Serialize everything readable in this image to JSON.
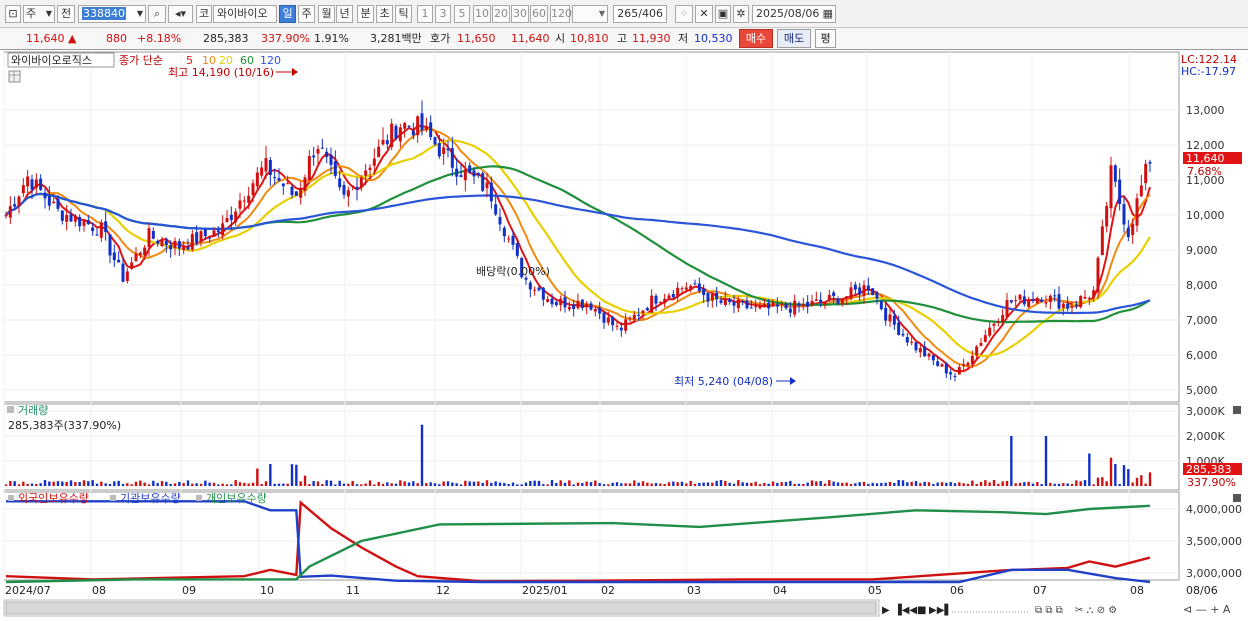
{
  "toolbar": {
    "period_label": "주",
    "prev_label": "전",
    "stock_code": "338840",
    "market_label": "코",
    "stock_name": "와이바이오",
    "periods": [
      "일",
      "주",
      "월",
      "년",
      "분",
      "초",
      "틱"
    ],
    "active_period": "일",
    "intervals": [
      "1",
      "3",
      "5",
      "10",
      "20",
      "30",
      "60",
      "120"
    ],
    "count_display": "265/406",
    "date": "2025/08/06"
  },
  "quote": {
    "price": "11,640",
    "change": "880",
    "change_pct": "+8.18%",
    "volume": "285,383",
    "volume_ratio": "337.90%",
    "turnover": "1.91%",
    "amount": "3,281백만",
    "ask_label": "호가",
    "ask1": "11,650",
    "bid1": "11,640",
    "open_label": "시",
    "open": "10,810",
    "high_label": "고",
    "high": "11,930",
    "low_label": "저",
    "low": "10,530",
    "buy_label": "매수",
    "sell_label": "매도",
    "avg_label": "평"
  },
  "price_panel": {
    "stock_name_label": "와이바이오로직스",
    "ma_title": "종가 단순",
    "ma_periods": [
      {
        "label": "5",
        "color": "#e01414"
      },
      {
        "label": "10",
        "color": "#f08a10"
      },
      {
        "label": "20",
        "color": "#e8d000"
      },
      {
        "label": "60",
        "color": "#1f8f3a"
      },
      {
        "label": "120",
        "color": "#2a55d8"
      }
    ],
    "high_annotation": "최고 14,190 (10/16)",
    "low_annotation": "최저 5,240 (04/08)",
    "dividend_annotation": "배당락(0.00%)",
    "lc_label": "LC:122.14",
    "hc_label": "HC:-17.97",
    "current_price_tag": "11,640",
    "current_pct_tag": "7.68%",
    "y_ticks": [
      "13,000",
      "12,000",
      "11,000",
      "10,000",
      "9,000",
      "8,000",
      "7,000",
      "6,000",
      "5,000"
    ]
  },
  "volume_panel": {
    "title": "거래량",
    "value_label": "285,383주(337.90%)",
    "y_ticks": [
      "3,000K",
      "2,000K",
      "1,000K"
    ],
    "tag_value": "285,383",
    "tag_pct": "337.90%"
  },
  "holdings_panel": {
    "legend": [
      {
        "label": "외국인보유수량",
        "color": "#d01010"
      },
      {
        "label": "기관보유수량",
        "color": "#2040c8"
      },
      {
        "label": "개인보유수량",
        "color": "#1f8f4a"
      }
    ],
    "y_ticks": [
      "4,000,000",
      "3,500,000",
      "3,000,000"
    ]
  },
  "x_axis": {
    "labels": [
      "2024/07",
      "08",
      "09",
      "10",
      "11",
      "12",
      "2025/01",
      "02",
      "03",
      "04",
      "05",
      "06",
      "07",
      "08"
    ],
    "right_label": "08/06"
  },
  "colors": {
    "up": "#d01010",
    "down": "#1030c8",
    "ma5": "#e01414",
    "ma10": "#f08a10",
    "ma20": "#e8d000",
    "ma60": "#1f8f3a",
    "ma120": "#2a55d8"
  }
}
